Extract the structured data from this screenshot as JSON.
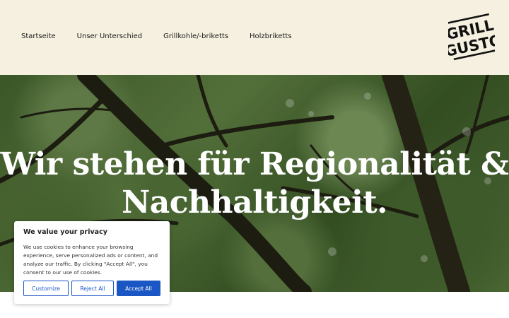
{
  "nav": {
    "items": [
      "Startseite",
      "Unser Unterschied",
      "Grillkohle/-briketts",
      "Holzbriketts"
    ]
  },
  "logo": {
    "line1": "GRILL",
    "line2": "GUSTO"
  },
  "hero": {
    "title_line1": "Wir stehen für Regionalität &",
    "title_line2": "Nachhaltigkeit."
  },
  "cookie_banner": {
    "title": "We value your privacy",
    "text": "We use cookies to enhance your browsing experience, serve personalized ads or content, and analyze our traffic. By clicking \"Accept All\", you consent to our use of cookies.",
    "customize_label": "Customize",
    "reject_label": "Reject All",
    "accept_label": "Accept All"
  },
  "colors": {
    "header_bg": "#f5f0df",
    "accent_blue": "#1a56c4",
    "text_dark": "#1a1a1a"
  }
}
